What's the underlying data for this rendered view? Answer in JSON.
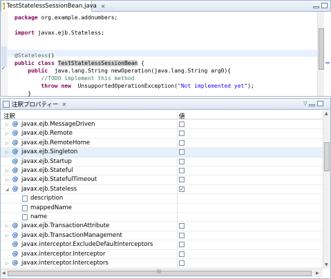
{
  "editor": {
    "tab_label": "TestStatelessSessionBean.java",
    "tab_icon": "java-file-icon",
    "code": [
      {
        "parts": [
          [
            "kw",
            "package"
          ],
          [
            "",
            "org.example.addnumbers;"
          ]
        ]
      },
      {
        "parts": []
      },
      {
        "parts": [
          [
            "kw",
            "import"
          ],
          [
            "",
            "javax.ejb.Stateless;"
          ]
        ]
      },
      {
        "parts": []
      },
      {
        "parts": []
      },
      {
        "parts": [
          [
            "an",
            "@Stateless"
          ],
          [
            "",
            "()"
          ]
        ]
      },
      {
        "parts": [
          [
            "kw",
            "public"
          ],
          [
            "",
            ""
          ],
          [
            "kw",
            "class"
          ],
          [
            "",
            ""
          ],
          [
            "hl",
            "TestStatelessSessionBean"
          ],
          [
            "",
            " {"
          ]
        ]
      },
      {
        "parts": [
          [
            "",
            "    "
          ],
          [
            "kw",
            "public"
          ],
          [
            "",
            " java.lang.String newOperation(java.lang.String arg0){"
          ]
        ]
      },
      {
        "parts": [
          [
            "cm",
            "        //TODO implement this method"
          ]
        ]
      },
      {
        "parts": [
          [
            "",
            "        "
          ],
          [
            "kw",
            "throw"
          ],
          [
            "",
            ""
          ],
          [
            "kw",
            "new"
          ],
          [
            "",
            " UnsupportedOperationException("
          ],
          [
            "st",
            "\"Not implemented yet\""
          ],
          [
            "",
            ");"
          ]
        ]
      },
      {
        "parts": [
          [
            "",
            "    }"
          ]
        ]
      }
    ]
  },
  "props": {
    "tab_label": "注釈プロパティー",
    "columns": [
      "注釈",
      "値"
    ],
    "rows": [
      {
        "name": "javax.ejb.MessageDriven",
        "kind": "annotation",
        "expand": "▷",
        "checked": false,
        "selected": false
      },
      {
        "name": "javax.ejb.Remote",
        "kind": "annotation",
        "expand": "▷",
        "checked": false,
        "selected": false
      },
      {
        "name": "javax.ejb.RemoteHome",
        "kind": "annotation",
        "expand": "▷",
        "checked": false,
        "selected": false
      },
      {
        "name": "javax.ejb.Singleton",
        "kind": "annotation",
        "expand": "▷",
        "checked": false,
        "selected": true
      },
      {
        "name": "javax.ejb.Startup",
        "kind": "annotation",
        "expand": "",
        "checked": false,
        "selected": false
      },
      {
        "name": "javax.ejb.Stateful",
        "kind": "annotation",
        "expand": "▷",
        "checked": false,
        "selected": false
      },
      {
        "name": "javax.ejb.StatefulTimeout",
        "kind": "annotation",
        "expand": "▷",
        "checked": false,
        "selected": false
      },
      {
        "name": "javax.ejb.Stateless",
        "kind": "annotation",
        "expand": "◢",
        "checked": true,
        "selected": false
      },
      {
        "name": "description",
        "kind": "attribute",
        "expand": "",
        "checked": null,
        "selected": false
      },
      {
        "name": "mappedName",
        "kind": "attribute",
        "expand": "",
        "checked": null,
        "selected": false
      },
      {
        "name": "name",
        "kind": "attribute",
        "expand": "",
        "checked": null,
        "selected": false
      },
      {
        "name": "javax.ejb.TransactionAttribute",
        "kind": "annotation",
        "expand": "▷",
        "checked": false,
        "selected": false
      },
      {
        "name": "javax.ejb.TransactionManagement",
        "kind": "annotation",
        "expand": "▷",
        "checked": false,
        "selected": false
      },
      {
        "name": "javax.interceptor.ExcludeDefaultInterceptors",
        "kind": "annotation",
        "expand": "",
        "checked": false,
        "selected": false
      },
      {
        "name": "javax.interceptor.Interceptor",
        "kind": "annotation",
        "expand": "",
        "checked": false,
        "selected": false
      },
      {
        "name": "javax.interceptor.Interceptors",
        "kind": "annotation",
        "expand": "▷",
        "checked": false,
        "selected": false
      }
    ]
  }
}
